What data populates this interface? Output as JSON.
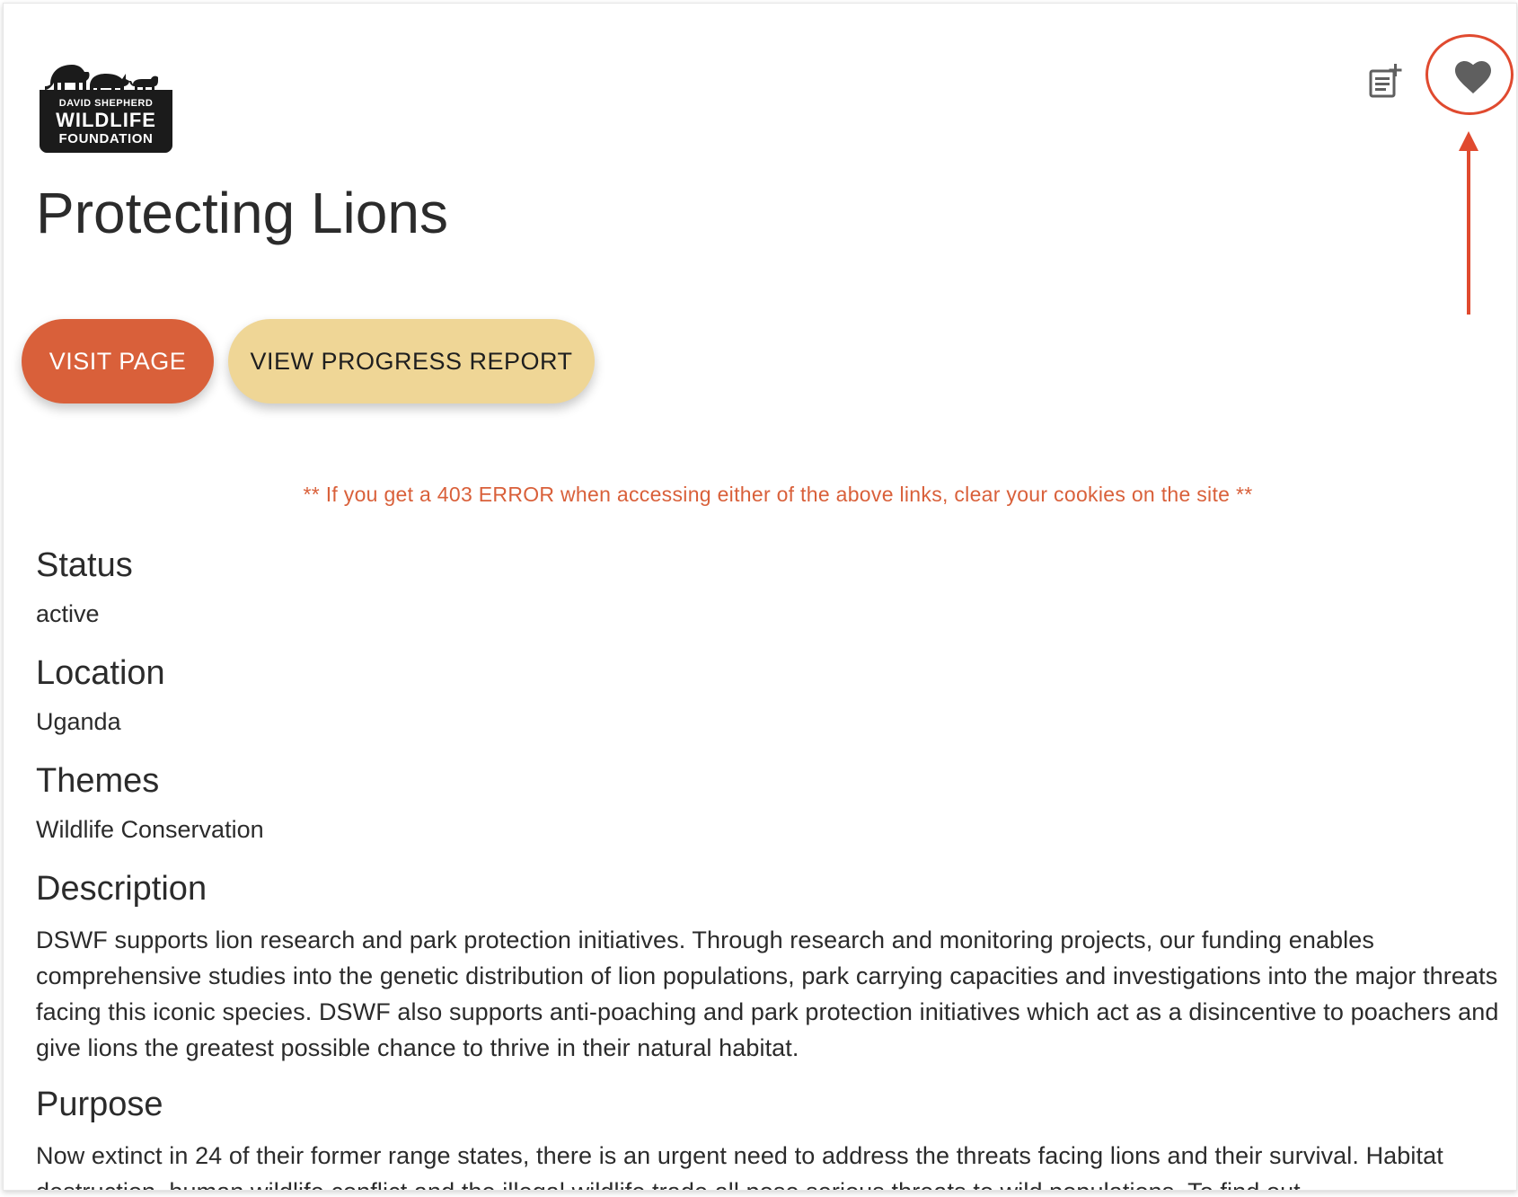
{
  "logo": {
    "line1": "DAVID SHEPHERD",
    "line2": "WILDLIFE",
    "line3": "FOUNDATION"
  },
  "icons": {
    "playlist": "playlist-add-icon",
    "favorite": "heart-icon"
  },
  "page_title": "Protecting Lions",
  "buttons": {
    "visit_label": "VISIT PAGE",
    "progress_label": "VIEW PROGRESS REPORT"
  },
  "notice": "** If you get a 403 ERROR when accessing either of the above links, clear your cookies on the site **",
  "sections": {
    "status": {
      "label": "Status",
      "value": "active"
    },
    "location": {
      "label": "Location",
      "value": "Uganda"
    },
    "themes": {
      "label": "Themes",
      "value": "Wildlife Conservation"
    },
    "description": {
      "label": "Description",
      "value": "DSWF supports lion research and park protection initiatives. Through research and monitoring projects, our funding enables comprehensive studies into the genetic distribution of lion populations, park carrying capacities and investigations into the major threats facing this iconic species. DSWF also supports anti-poaching and park protection initiatives which act as a disincentive to poachers and give lions the greatest possible chance to thrive in their natural habitat."
    },
    "purpose": {
      "label": "Purpose",
      "value": "Now extinct in 24 of their former range states, there is an urgent need to address the threats facing lions and their survival. Habitat destruction, human wildlife conflict and the illegal wildlife trade all pose serious threats to wild populations. To find out"
    }
  },
  "colors": {
    "accent_orange": "#d9603a",
    "accent_yellow": "#efd696",
    "annotation_red": "#e04a2f",
    "icon_gray": "#5f5f5f"
  }
}
